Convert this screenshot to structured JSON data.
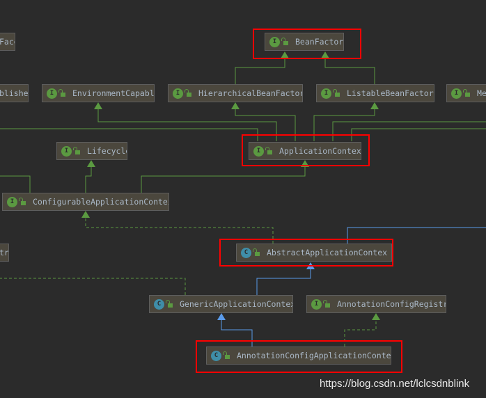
{
  "colors": {
    "background": "#2b2b2b",
    "interface_icon": "#5b9a41",
    "class_icon": "#3f8ea8",
    "interface_edge": "#5b9a41",
    "class_edge": "#5a9bea",
    "highlight": "#ff0000"
  },
  "nodes": {
    "face": {
      "label": "Face"
    },
    "publisher": {
      "label": "blishe"
    },
    "bean_factory": {
      "label": "BeanFactory",
      "kind": "I"
    },
    "environment_capable": {
      "label": "EnvironmentCapable",
      "kind": "I"
    },
    "hierarchical_bean_factory": {
      "label": "HierarchicalBeanFactory",
      "kind": "I"
    },
    "listable_bean_factory": {
      "label": "ListableBeanFactory",
      "kind": "I"
    },
    "message": {
      "label": "Mes",
      "kind": "I"
    },
    "lifecycle": {
      "label": "Lifecycle",
      "kind": "I"
    },
    "application_context": {
      "label": "ApplicationContext",
      "kind": "I"
    },
    "configurable_application_context": {
      "label": "ConfigurableApplicationContex",
      "kind": "I"
    },
    "registry": {
      "label": "try"
    },
    "abstract_application_context": {
      "label": "AbstractApplicationContex",
      "kind": "C"
    },
    "generic_application_context": {
      "label": "GenericApplicationContex",
      "kind": "C"
    },
    "annotation_config_registry": {
      "label": "AnnotationConfigRegistr",
      "kind": "I"
    },
    "annotation_config_application_context": {
      "label": "AnnotationConfigApplicationContex",
      "kind": "C"
    }
  },
  "watermark": "https://blog.csdn.net/lclcsdnblink"
}
